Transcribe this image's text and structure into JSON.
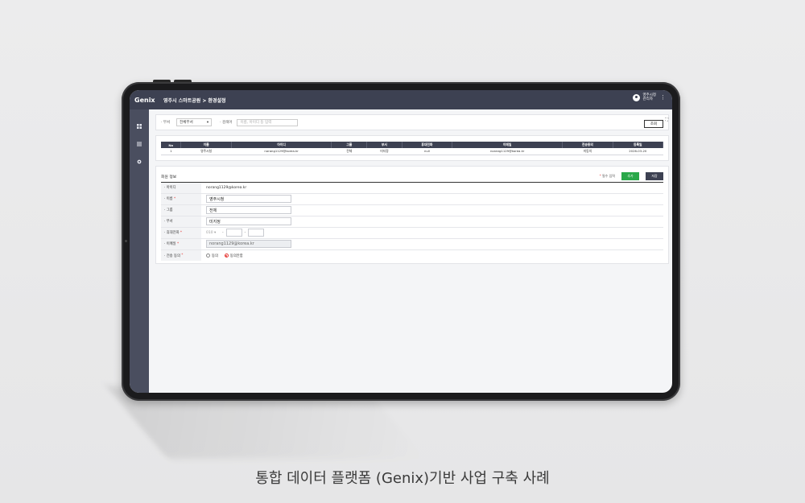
{
  "app": {
    "logo": "Genix",
    "breadcrumb": "영주시 스마트공원 > 환경설정",
    "user": {
      "name": "영주시청",
      "role": "관리자"
    },
    "menu_glyph": "⋮"
  },
  "sidebar": {
    "icons": [
      "dashboard-icon",
      "list-icon",
      "gear-icon"
    ]
  },
  "filter": {
    "dept_label": "· 부서",
    "dept_value": "전체부서",
    "search_label": "· 검색어",
    "search_placeholder": "이름, 아이디 등 입력",
    "search_button": "조회"
  },
  "table": {
    "columns": [
      "No",
      "이름",
      "아이디",
      "그룹",
      "부서",
      "휴대전화",
      "이메일",
      "전송동의",
      "등록일"
    ],
    "rows": [
      [
        "1",
        "영주시청",
        "norang1129@korea.kr",
        "전체",
        "미지정",
        "null",
        "norang1129@korea.kr",
        "미동의",
        "2026-03-20"
      ]
    ]
  },
  "form": {
    "title": "회원 정보",
    "required_note": "필수 입력",
    "required_star": "*",
    "add_button": "추가",
    "save_button": "저장",
    "id_label": "· 아이디",
    "id_value": "norang1129@korea.kr",
    "name_label": "· 이름",
    "name_value": "영주시청",
    "group_label": "· 그룹",
    "group_value": "전체",
    "dept_label": "· 부서",
    "dept_value": "미지정",
    "phone_label": "· 휴대전화",
    "phone_prefix": "010",
    "phone_dash": "-",
    "email_label": "· 이메일",
    "email_value": "norang1129@korea.kr",
    "consent_label": "· 전송 동의",
    "consent_options": [
      "동의",
      "동의안함"
    ],
    "consent_selected": "동의안함"
  },
  "caption": "통합 데이터 플랫폼 (Genix)기반 사업 구축 사례"
}
